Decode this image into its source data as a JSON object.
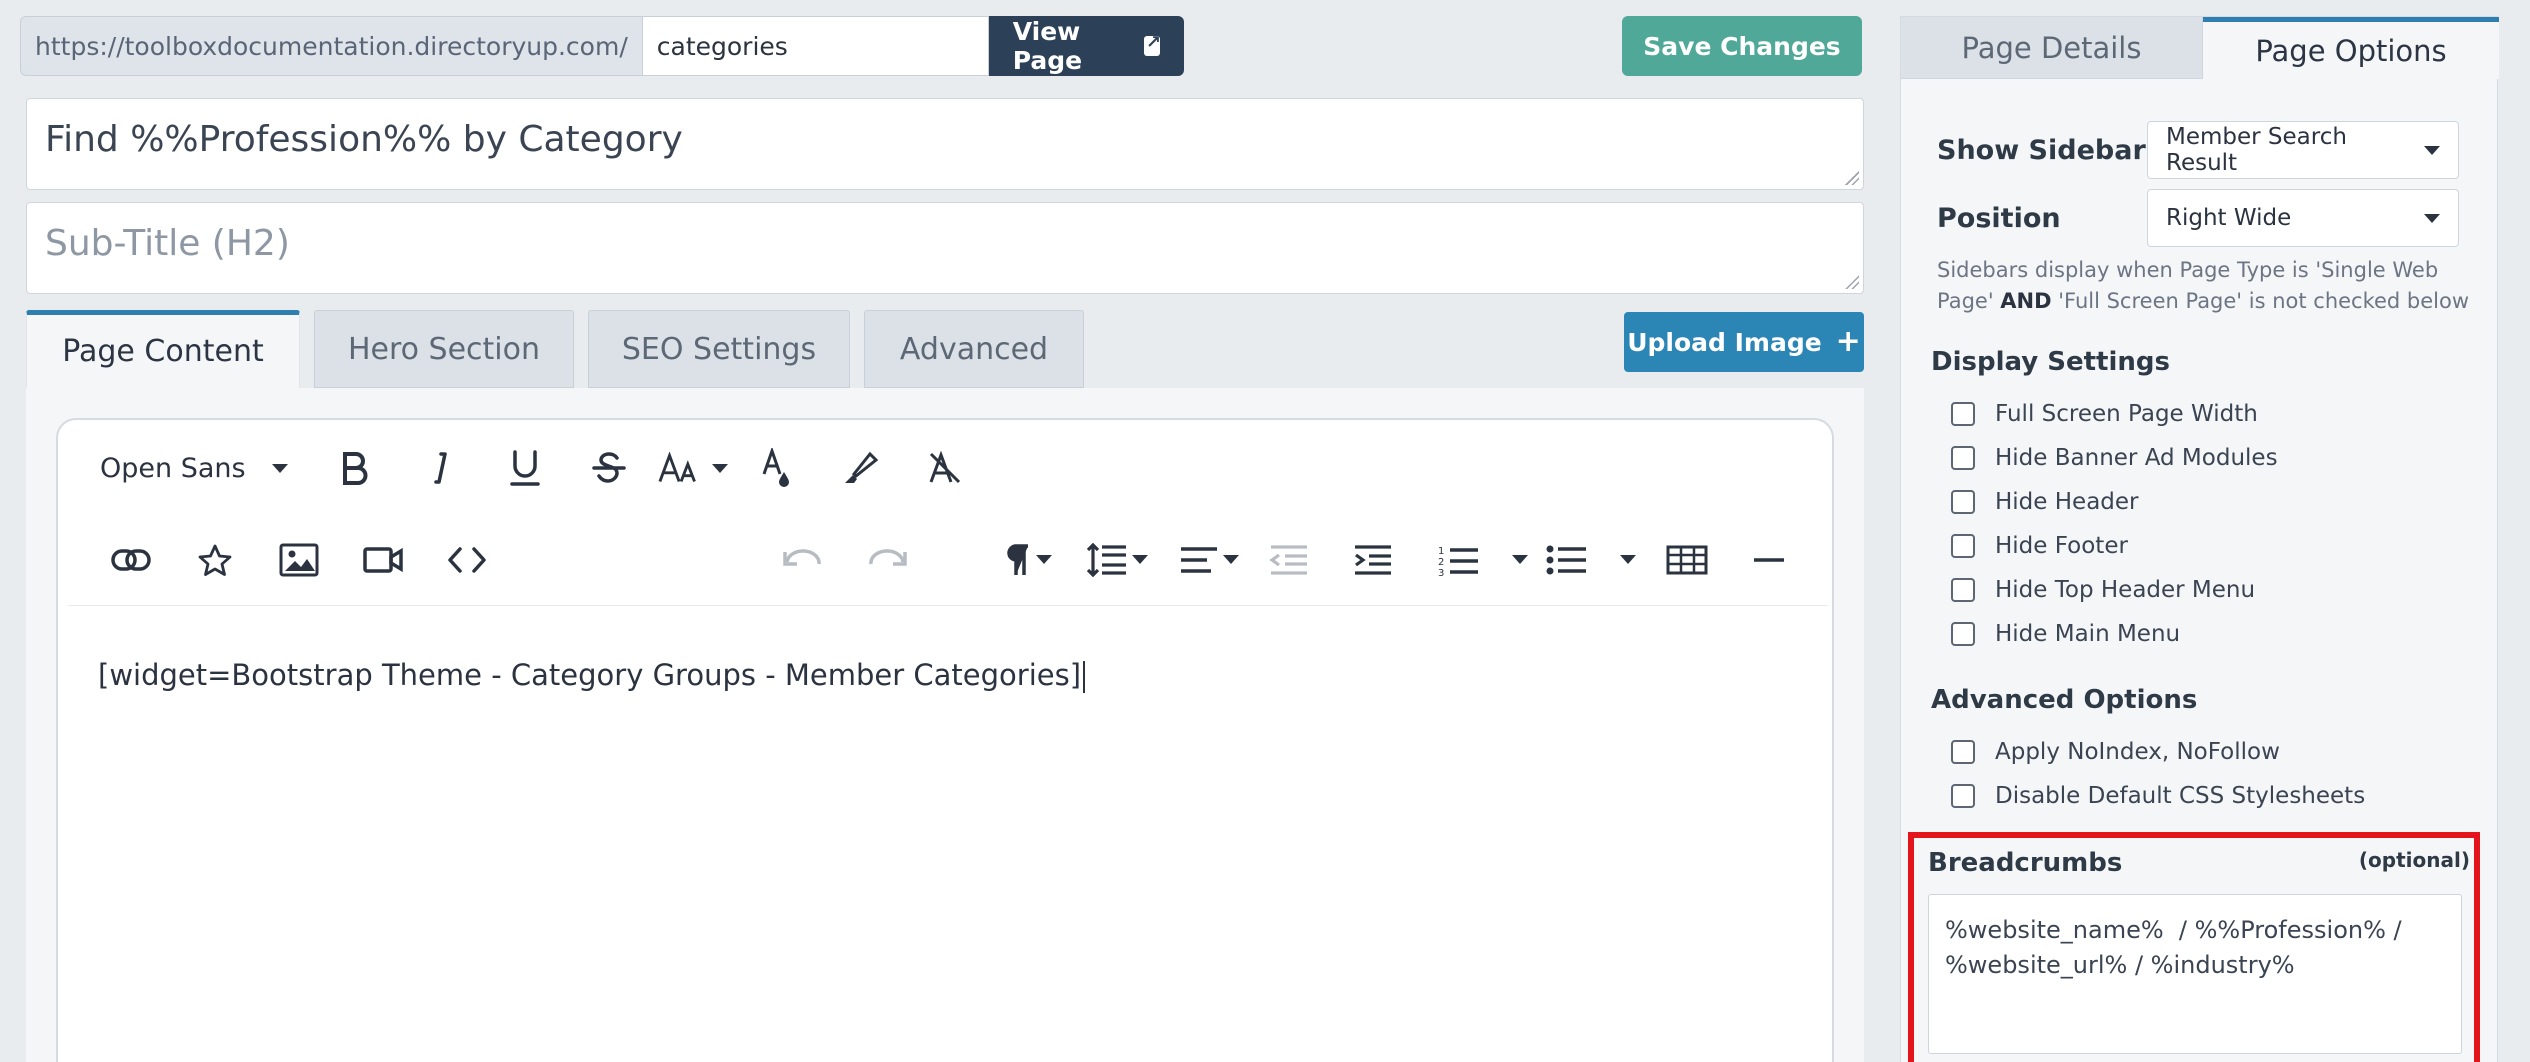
{
  "url_bar": {
    "prefix": "https://toolboxdocumentation.directoryup.com/",
    "slug_value": "categories",
    "view_page_label": "View Page"
  },
  "save_label": "Save Changes",
  "title_value": "Find %%Profession%% by Category",
  "subtitle_placeholder": "Sub-Title (H2)",
  "tabs": [
    {
      "label": "Page Content",
      "active": true
    },
    {
      "label": "Hero Section",
      "active": false
    },
    {
      "label": "SEO Settings",
      "active": false
    },
    {
      "label": "Advanced",
      "active": false
    }
  ],
  "upload_label": "Upload Image",
  "editor": {
    "font_family_value": "Open Sans",
    "content": "[widget=Bootstrap Theme - Category Groups - Member Categories]",
    "toolbar_row1_icons": [
      "bold-icon",
      "italic-icon",
      "underline-icon",
      "strikethrough-icon",
      "font-size-icon",
      "text-color-icon",
      "highlight-icon",
      "clear-format-icon"
    ],
    "toolbar_row2_icons": [
      "link-icon",
      "star-icon",
      "image-icon",
      "video-icon",
      "code-icon",
      "undo-icon",
      "redo-icon",
      "paragraph-icon",
      "line-height-icon",
      "align-icon",
      "outdent-icon",
      "indent-icon",
      "ordered-list-icon",
      "unordered-list-icon",
      "table-icon",
      "horizontal-rule-icon"
    ]
  },
  "panel": {
    "tab_details": "Page Details",
    "tab_options": "Page Options",
    "show_sidebar_label": "Show Sidebar",
    "show_sidebar_value": "Member Search Result",
    "position_label": "Position",
    "position_value": "Right Wide",
    "help_part1": "Sidebars display when Page Type is 'Single Web Page' ",
    "help_bold": "AND",
    "help_part2": " 'Full Screen Page' is not checked below",
    "display_settings_title": "Display Settings",
    "display_settings": [
      {
        "label": "Full Screen Page Width",
        "checked": false
      },
      {
        "label": "Hide Banner Ad Modules",
        "checked": false
      },
      {
        "label": "Hide Header",
        "checked": false
      },
      {
        "label": "Hide Footer",
        "checked": false
      },
      {
        "label": "Hide Top Header Menu",
        "checked": false
      },
      {
        "label": "Hide Main Menu",
        "checked": false
      }
    ],
    "advanced_options_title": "Advanced Options",
    "advanced_options": [
      {
        "label": "Apply NoIndex, NoFollow",
        "checked": false
      },
      {
        "label": "Disable Default CSS Stylesheets",
        "checked": false
      }
    ],
    "breadcrumbs_label": "Breadcrumbs",
    "breadcrumbs_optional": "(optional)",
    "breadcrumbs_value": "%website_name%  / %%Profession% / %website_url% / %industry%"
  },
  "colors": {
    "save": "#4fa898",
    "upload": "#2b86b6",
    "view_page": "#2c4158",
    "active_tab_border": "#2e7fb0",
    "highlight_border": "#e3141b"
  }
}
